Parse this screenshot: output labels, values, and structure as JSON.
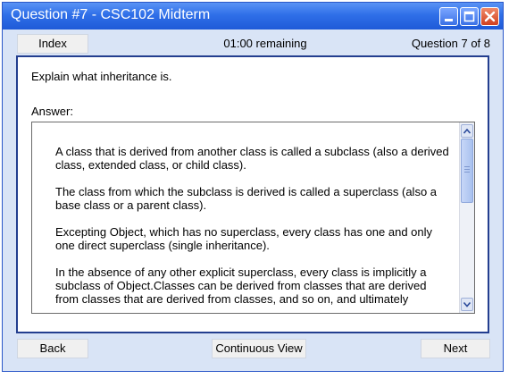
{
  "window": {
    "title": "Question #7 - CSC102 Midterm",
    "controls": {
      "minimize": "minimize-icon",
      "maximize": "maximize-icon",
      "close": "close-icon"
    }
  },
  "toolbar": {
    "index_label": "Index",
    "timer": "01:00 remaining",
    "question_counter": "Question 7 of 8"
  },
  "question": {
    "prompt": "Explain what inheritance is.",
    "answer_label": "Answer:",
    "answer_paragraphs": [
      "A class that is derived from another class is called a subclass (also a derived class, extended class, or child class).",
      "The class from which the subclass is derived is called a superclass (also a base class or a parent class).",
      "Excepting Object, which has no superclass, every class has one and only one direct superclass (single inheritance).",
      "In the absence of any other explicit superclass, every class is implicitly a subclass of Object.Classes can be derived from classes that are derived from classes that are derived from classes, and so on, and ultimately"
    ]
  },
  "footer": {
    "back_label": "Back",
    "continuous_label": "Continuous View",
    "next_label": "Next"
  },
  "colors": {
    "titlebar": "#2f6fe8",
    "window_bg": "#d9e4f6",
    "panel_border": "#233e8f"
  }
}
